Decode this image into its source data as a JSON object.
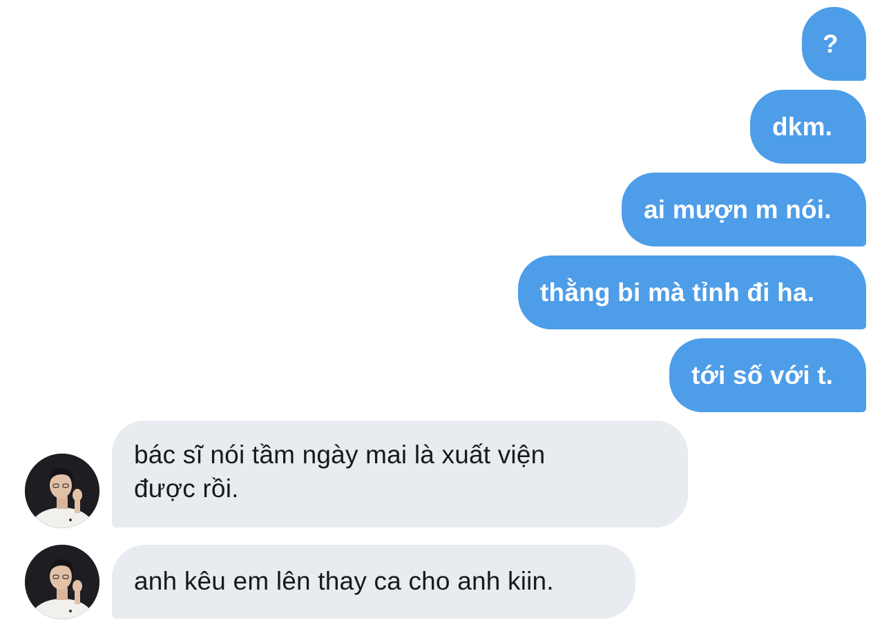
{
  "messages": [
    {
      "direction": "sent",
      "text": "?"
    },
    {
      "direction": "sent",
      "text": "dkm."
    },
    {
      "direction": "sent",
      "text": "ai mượn m nói."
    },
    {
      "direction": "sent",
      "text": "thằng bi mà tỉnh đi ha."
    },
    {
      "direction": "sent",
      "text": "tới số với t."
    },
    {
      "direction": "received",
      "lines": [
        "bác sĩ nói tầm ngày mai là xuất viện",
        "được rồi."
      ]
    },
    {
      "direction": "received",
      "text": "anh kêu em lên thay ca cho anh kiin."
    }
  ],
  "colors": {
    "sent_bubble": "#4d9de8",
    "sent_text": "#ffffff",
    "received_bubble": "#e8ebef",
    "received_text": "#17191c",
    "background": "#ffffff"
  },
  "icons": {
    "contact_avatar": "avatar-photo"
  }
}
